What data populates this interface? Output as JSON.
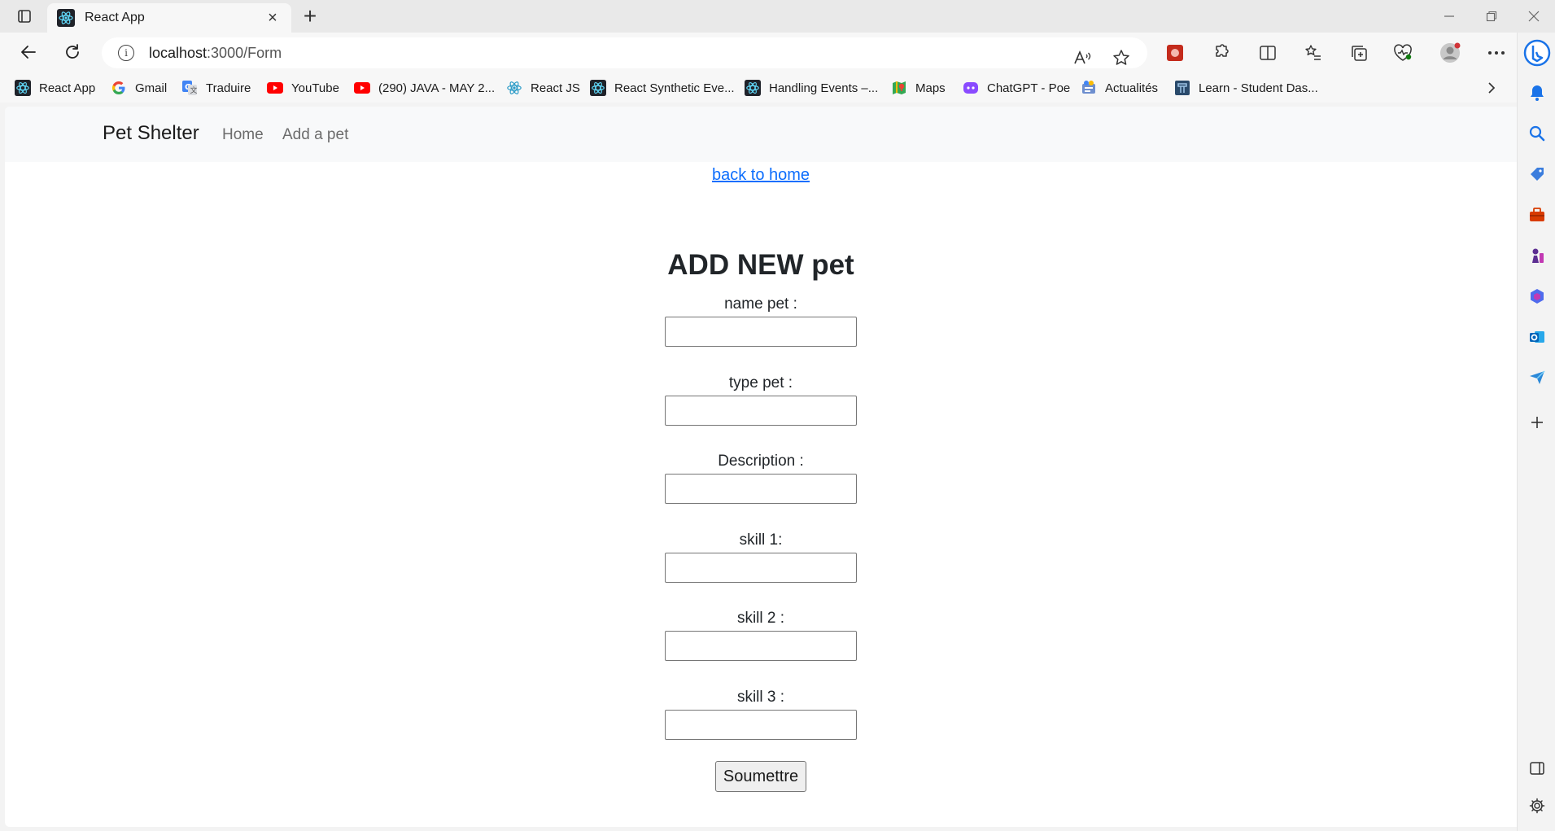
{
  "browser": {
    "tab": {
      "title": "React App"
    },
    "address": {
      "host": "localhost",
      "path": ":3000/Form"
    },
    "bookmarks": [
      {
        "label": "React App",
        "icon": "react-icon"
      },
      {
        "label": "Gmail",
        "icon": "google-icon"
      },
      {
        "label": "Traduire",
        "icon": "translate-icon"
      },
      {
        "label": "YouTube",
        "icon": "youtube-icon"
      },
      {
        "label": "(290) JAVA - MAY 2...",
        "icon": "youtube-icon"
      },
      {
        "label": "React JS",
        "icon": "react-icon"
      },
      {
        "label": "React Synthetic Eve...",
        "icon": "react-icon"
      },
      {
        "label": "Handling Events –...",
        "icon": "react-icon"
      },
      {
        "label": "Maps",
        "icon": "maps-icon"
      },
      {
        "label": "ChatGPT - Poe",
        "icon": "poe-icon"
      },
      {
        "label": "Actualités",
        "icon": "news-icon"
      },
      {
        "label": "Learn - Student Das...",
        "icon": "learn-icon"
      }
    ]
  },
  "app": {
    "brand": "Pet Shelter",
    "nav": {
      "home": "Home",
      "add": "Add a pet"
    },
    "back_link": "back to home",
    "form": {
      "title": "ADD NEW pet",
      "fields": [
        {
          "label": "name pet :",
          "value": ""
        },
        {
          "label": "type pet :",
          "value": ""
        },
        {
          "label": "Description :",
          "value": ""
        },
        {
          "label": "skill 1:",
          "value": ""
        },
        {
          "label": "skill 2 :",
          "value": ""
        },
        {
          "label": "skill 3 :",
          "value": ""
        }
      ],
      "submit": "Soumettre"
    }
  },
  "colors": {
    "link": "#0d6efd",
    "navbar_bg": "#f8f9fa",
    "youtube": "#ff0000",
    "bing": "#1a73e8"
  }
}
